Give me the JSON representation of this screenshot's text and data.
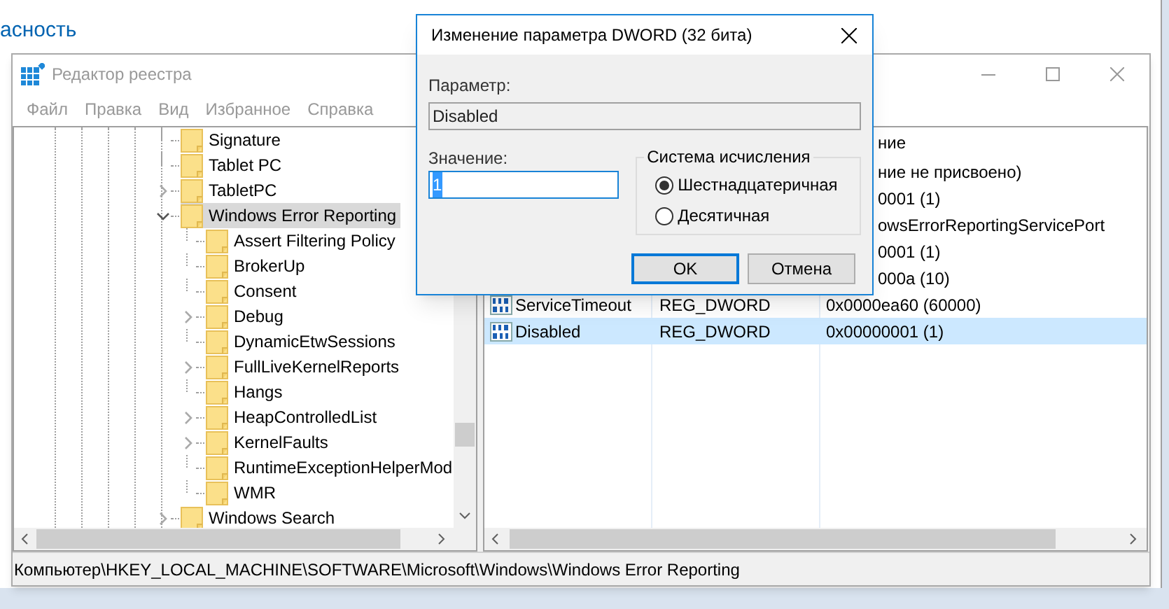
{
  "background_window": {
    "link": "асность"
  },
  "window": {
    "title": "Редактор реестра"
  },
  "menu": [
    "Файл",
    "Правка",
    "Вид",
    "Избранное",
    "Справка"
  ],
  "tree": [
    {
      "label": "Signature",
      "has_children": false,
      "selected": false
    },
    {
      "label": "Tablet PC",
      "has_children": false,
      "selected": false
    },
    {
      "label": "TabletPC",
      "has_children": true,
      "expanded": false,
      "selected": false
    },
    {
      "label": "Windows Error Reporting",
      "has_children": true,
      "expanded": true,
      "selected": true,
      "children": [
        {
          "label": "Assert Filtering Policy",
          "has_children": false,
          "selected": false
        },
        {
          "label": "BrokerUp",
          "has_children": false,
          "selected": false
        },
        {
          "label": "Consent",
          "has_children": false,
          "selected": false
        },
        {
          "label": "Debug",
          "has_children": true,
          "expanded": false,
          "selected": false
        },
        {
          "label": "DynamicEtwSessions",
          "has_children": false,
          "selected": false
        },
        {
          "label": "FullLiveKernelReports",
          "has_children": true,
          "expanded": false,
          "selected": false
        },
        {
          "label": "Hangs",
          "has_children": false,
          "selected": false
        },
        {
          "label": "HeapControlledList",
          "has_children": true,
          "expanded": false,
          "selected": false
        },
        {
          "label": "KernelFaults",
          "has_children": true,
          "expanded": false,
          "selected": false
        },
        {
          "label": "RuntimeExceptionHelperMod",
          "has_children": false,
          "selected": false
        },
        {
          "label": "WMR",
          "has_children": false,
          "selected": false
        }
      ]
    },
    {
      "label": "Windows Search",
      "has_children": true,
      "expanded": false,
      "selected": false
    }
  ],
  "values": {
    "header": "ние",
    "rows": [
      {
        "data": "ние не присвоено)",
        "selected": false
      },
      {
        "data": "0001 (1)",
        "selected": false
      },
      {
        "data": "owsErrorReportingServicePort",
        "selected": false
      },
      {
        "data": "0001 (1)",
        "selected": false
      },
      {
        "data": "000a (10)",
        "selected": false
      },
      {
        "kind": "dword",
        "name": "ServiceTimeout",
        "type": "REG_DWORD",
        "data": "0x0000ea60 (60000)",
        "selected": false
      },
      {
        "kind": "dword",
        "name": "Disabled",
        "type": "REG_DWORD",
        "data": "0x00000001 (1)",
        "selected": true
      }
    ]
  },
  "status_bar": "Компьютер\\HKEY_LOCAL_MACHINE\\SOFTWARE\\Microsoft\\Windows\\Windows Error Reporting",
  "dialog": {
    "title": "Изменение параметра DWORD (32 бита)",
    "param_label": "Параметр:",
    "param_value": "Disabled",
    "value_label": "Значение:",
    "value": "1",
    "value_selected": true,
    "base_group": "Система исчисления",
    "bases": [
      {
        "label": "Шестнадцатеричная",
        "selected": true
      },
      {
        "label": "Десятичная",
        "selected": false
      }
    ],
    "buttons": [
      {
        "label": "OK",
        "default": true
      },
      {
        "label": "Отмена",
        "default": false
      }
    ]
  }
}
